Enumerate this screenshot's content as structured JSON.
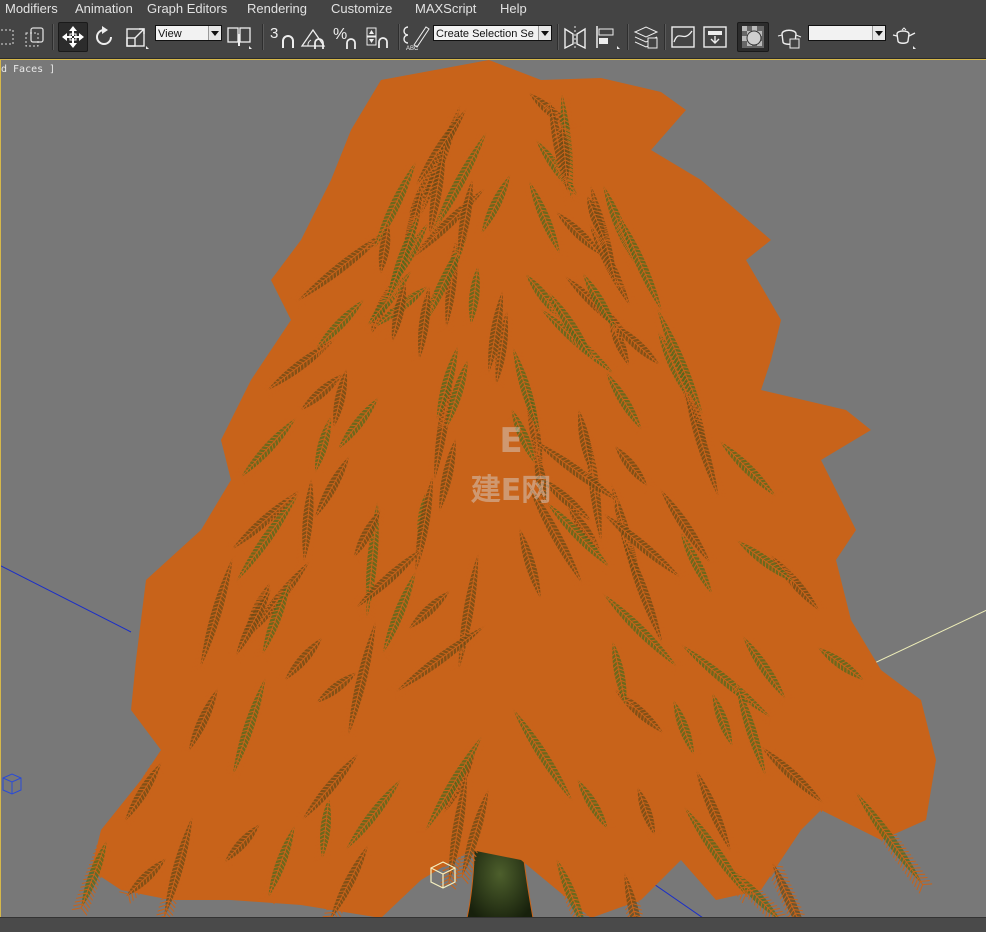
{
  "menu": {
    "items": [
      "Modifiers",
      "Animation",
      "Graph Editors",
      "Rendering",
      "Customize",
      "MAXScript",
      "Help"
    ]
  },
  "toolbar": {
    "reference_coord_value": "View",
    "named_selection_placeholder": "Create Selection Se",
    "snap_angle_label": "3",
    "render_preset_value": ""
  },
  "viewport": {
    "label": "d Faces ]",
    "background_color": "#787878",
    "wire_color": "#c8631a",
    "leaf_color": "#4f6a1e",
    "trunk_color": "#2c3a18",
    "frame_color": "#d6b84a"
  },
  "watermark": {
    "text": "建E网"
  }
}
